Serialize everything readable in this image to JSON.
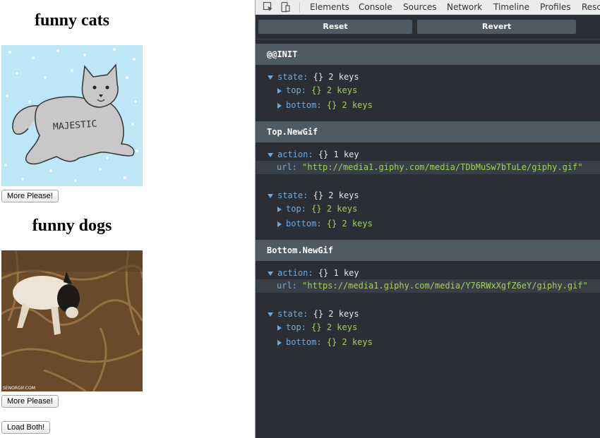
{
  "app": {
    "cats_title": "funny cats",
    "dogs_title": "funny dogs",
    "cats_button": "More Please!",
    "dogs_button": "More Please!",
    "load_both_button": "Load Both!",
    "cat_text": "MAJESTIC",
    "dog_watermark": "SENORGIF.COM"
  },
  "devtools": {
    "tabs": [
      "Elements",
      "Console",
      "Sources",
      "Network",
      "Timeline",
      "Profiles",
      "Resc"
    ],
    "reset_label": "Reset",
    "revert_label": "Revert",
    "actions": [
      {
        "name": "@@INIT",
        "state": {
          "label": "state:",
          "braces": "{}",
          "count": "2 keys",
          "top": {
            "label": "top:",
            "braces": "{}",
            "count": "2 keys"
          },
          "bottom": {
            "label": "bottom:",
            "braces": "{}",
            "count": "2 keys"
          }
        }
      },
      {
        "name": "Top.NewGif",
        "action": {
          "label": "action:",
          "braces": "{}",
          "count": "1 key",
          "url_label": "url:",
          "url_value": "\"http://media1.giphy.com/media/TDbMuSw7bTuLe/giphy.gif\""
        },
        "state": {
          "label": "state:",
          "braces": "{}",
          "count": "2 keys",
          "top": {
            "label": "top:",
            "braces": "{}",
            "count": "2 keys"
          },
          "bottom": {
            "label": "bottom:",
            "braces": "{}",
            "count": "2 keys"
          }
        }
      },
      {
        "name": "Bottom.NewGif",
        "action": {
          "label": "action:",
          "braces": "{}",
          "count": "1 key",
          "url_label": "url:",
          "url_value": "\"https://media1.giphy.com/media/Y76RWxXgfZ6eY/giphy.gif\""
        },
        "state": {
          "label": "state:",
          "braces": "{}",
          "count": "2 keys",
          "top": {
            "label": "top:",
            "braces": "{}",
            "count": "2 keys"
          },
          "bottom": {
            "label": "bottom:",
            "braces": "{}",
            "count": "2 keys"
          }
        }
      }
    ]
  },
  "colors": {
    "devtools_bg": "#2b2e34",
    "header_bg": "#4f5a65",
    "key_blue": "#6fa8dc",
    "string_green": "#a3d05a"
  }
}
